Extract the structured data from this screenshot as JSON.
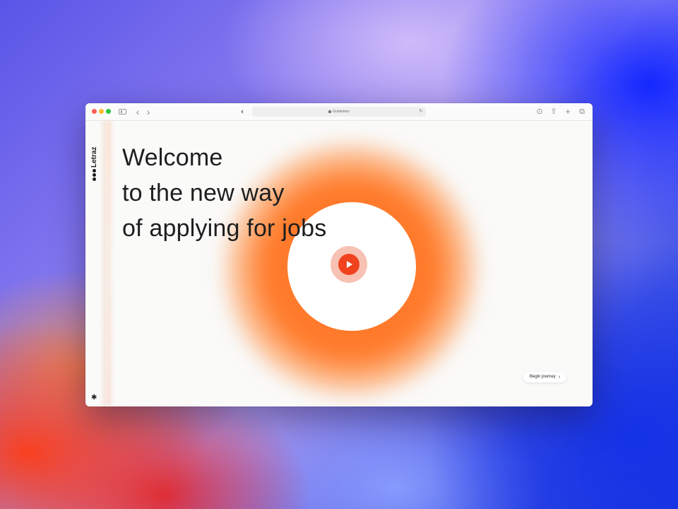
{
  "browser": {
    "address_text": "Guidelines",
    "icons": {
      "back": "‹",
      "forward": "›",
      "shield": "◐",
      "reload": "↻",
      "download": "⊙",
      "share": "⇪",
      "new_tab": "+",
      "tabs": "⧉"
    }
  },
  "sidebar": {
    "logo_text": "Letraz",
    "settings_icon": "✱"
  },
  "hero": {
    "line1": "Welcome",
    "line2": "to the new way",
    "line3": "of applying for jobs"
  },
  "cta": {
    "label": "Begin journey",
    "chevron": "›"
  },
  "colors": {
    "accent": "#f0421e",
    "glow": "#ff7a2a"
  }
}
